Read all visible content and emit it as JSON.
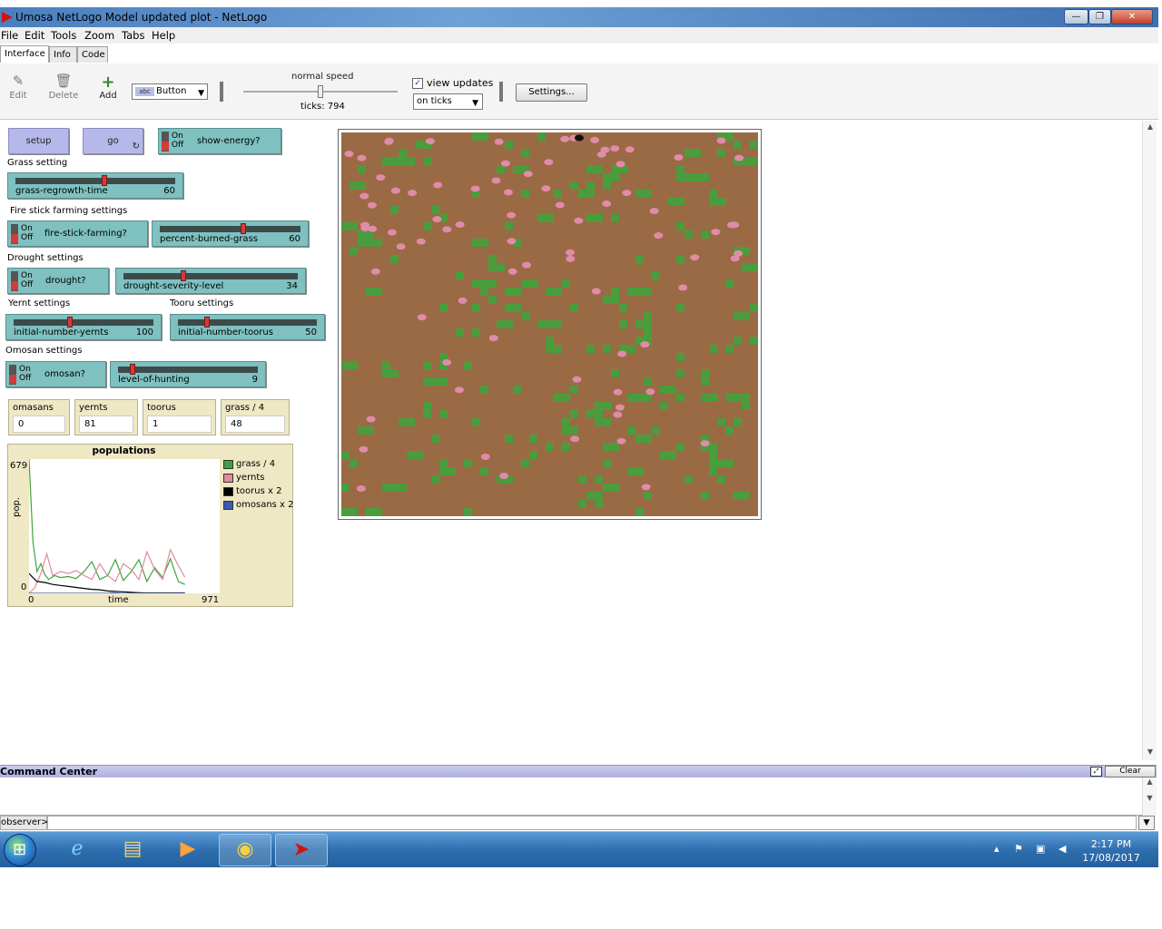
{
  "window": {
    "title": "Umosa NetLogo Model updated plot - NetLogo",
    "minimize": "—",
    "maximize": "❐",
    "close": "✕"
  },
  "menu": [
    "File",
    "Edit",
    "Tools",
    "Zoom",
    "Tabs",
    "Help"
  ],
  "tabs": [
    "Interface",
    "Info",
    "Code"
  ],
  "toolbar": {
    "edit": "Edit",
    "delete": "Delete",
    "add": "Add",
    "widget_type": "Button",
    "widget_icon_text": "abc",
    "speed_label": "normal speed",
    "ticks_label": "ticks: 794",
    "view_updates_label": "view updates",
    "view_updates_checked": true,
    "update_mode": "on ticks",
    "settings_label": "Settings..."
  },
  "buttons": {
    "setup": "setup",
    "go": "go"
  },
  "switch_on": "On",
  "switch_off": "Off",
  "switches": {
    "show_energy": "show-energy?",
    "fire_stick": "fire-stick-farming?",
    "drought": "drought?",
    "omosan": "omosan?"
  },
  "sections": {
    "grass": "Grass setting",
    "fire": "Fire stick farming settings",
    "drought": "Drought settings",
    "yernt": "Yernt settings",
    "tooru": "Tooru settings",
    "omosan": "Omosan settings"
  },
  "sliders": {
    "grass_regrowth": {
      "label": "grass-regrowth-time",
      "value": 60,
      "fraction": 0.56
    },
    "percent_burned": {
      "label": "percent-burned-grass",
      "value": 60,
      "fraction": 0.6
    },
    "drought_severity": {
      "label": "drought-severity-level",
      "value": 34,
      "fraction": 0.34
    },
    "initial_yernts": {
      "label": "initial-number-yernts",
      "value": 100,
      "fraction": 0.4
    },
    "initial_toorus": {
      "label": "initial-number-toorus",
      "value": 50,
      "fraction": 0.2
    },
    "level_hunting": {
      "label": "level-of-hunting",
      "value": 9,
      "fraction": 0.09
    }
  },
  "monitors": [
    {
      "label": "omasans",
      "value": "0"
    },
    {
      "label": "yernts",
      "value": "81"
    },
    {
      "label": "toorus",
      "value": "1"
    },
    {
      "label": "grass / 4",
      "value": "48"
    }
  ],
  "plot": {
    "title": "populations",
    "ylabel": "pop.",
    "xlabel": "time",
    "ymax": "679",
    "ymin": "0",
    "xmin": "0",
    "xmax": "971",
    "legend": [
      {
        "name": "grass / 4",
        "color": "#3ea33e"
      },
      {
        "name": "yernts",
        "color": "#e08b9b"
      },
      {
        "name": "toorus x 2",
        "color": "#000000"
      },
      {
        "name": "omosans x 2",
        "color": "#3a5bb0"
      }
    ]
  },
  "chart_data": {
    "type": "line",
    "title": "populations",
    "xlabel": "time",
    "ylabel": "pop.",
    "xlim": [
      0,
      971
    ],
    "ylim": [
      0,
      679
    ],
    "legend": "right",
    "series": [
      {
        "name": "grass / 4",
        "color": "#3ea33e",
        "x": [
          0,
          20,
          40,
          60,
          80,
          100,
          130,
          160,
          200,
          240,
          280,
          320,
          360,
          400,
          440,
          480,
          520,
          560,
          600,
          640,
          680,
          720,
          760,
          794
        ],
        "y": [
          679,
          260,
          110,
          150,
          95,
          70,
          90,
          80,
          85,
          75,
          110,
          160,
          70,
          90,
          170,
          65,
          110,
          170,
          60,
          130,
          80,
          175,
          60,
          45
        ]
      },
      {
        "name": "yernts",
        "color": "#e08b9b",
        "x": [
          0,
          30,
          60,
          90,
          120,
          160,
          200,
          240,
          280,
          320,
          360,
          400,
          440,
          480,
          520,
          560,
          600,
          640,
          680,
          720,
          760,
          794
        ],
        "y": [
          0,
          30,
          100,
          200,
          90,
          110,
          100,
          115,
          90,
          70,
          150,
          90,
          60,
          150,
          120,
          70,
          210,
          120,
          70,
          220,
          140,
          81
        ]
      },
      {
        "name": "toorus x 2",
        "color": "#000000",
        "x": [
          0,
          20,
          40,
          80,
          120,
          160,
          200,
          240,
          280,
          320,
          360,
          400,
          440,
          480,
          520,
          560,
          600,
          640,
          680,
          720,
          760,
          794
        ],
        "y": [
          100,
          80,
          60,
          55,
          45,
          40,
          35,
          30,
          25,
          20,
          18,
          12,
          10,
          8,
          5,
          3,
          2,
          2,
          2,
          2,
          2,
          2
        ]
      },
      {
        "name": "omosans x 2",
        "color": "#3a5bb0",
        "x": [
          0,
          400,
          430,
          470,
          794
        ],
        "y": [
          0,
          0,
          3,
          0,
          0
        ]
      }
    ]
  },
  "world": {
    "background": "#9a6a44",
    "grass_color": "#4a9c3c",
    "yernt_color": "#e08ba8",
    "tooru_color": "#111111"
  },
  "command_center": {
    "title": "Command Center",
    "clear": "Clear",
    "prompt": "observer>"
  },
  "taskbar": {
    "time": "2:17 PM",
    "date": "17/08/2017"
  }
}
